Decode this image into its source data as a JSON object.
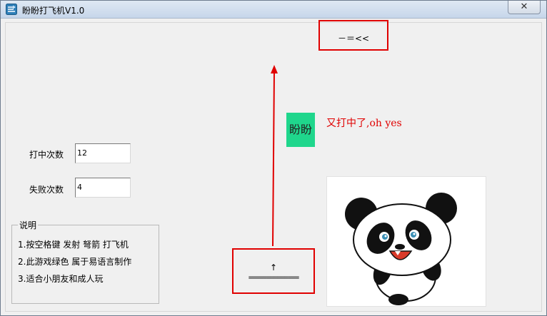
{
  "window": {
    "title": "盼盼打飞机V1.0",
    "close_label": "✕"
  },
  "game": {
    "target_text": "－＝<<",
    "green_block_text": "盼盼",
    "hit_message": "又打中了,oh yes",
    "plane_arrow": "↑",
    "plane_base": "=============="
  },
  "stats": {
    "hits_label": "打中次数",
    "hits_value": "12",
    "fails_label": "失败次数",
    "fails_value": "4"
  },
  "help": {
    "legend": "说明",
    "lines": [
      "1.按空格键 发射 弩箭 打飞机",
      "2.此游戏绿色 属于易语言制作",
      "3.适合小朋友和成人玩"
    ]
  },
  "colors": {
    "accent_red": "#e00000",
    "green_block": "#1fd68c"
  },
  "icons": [
    "app-icon",
    "close-icon",
    "panda-image"
  ]
}
